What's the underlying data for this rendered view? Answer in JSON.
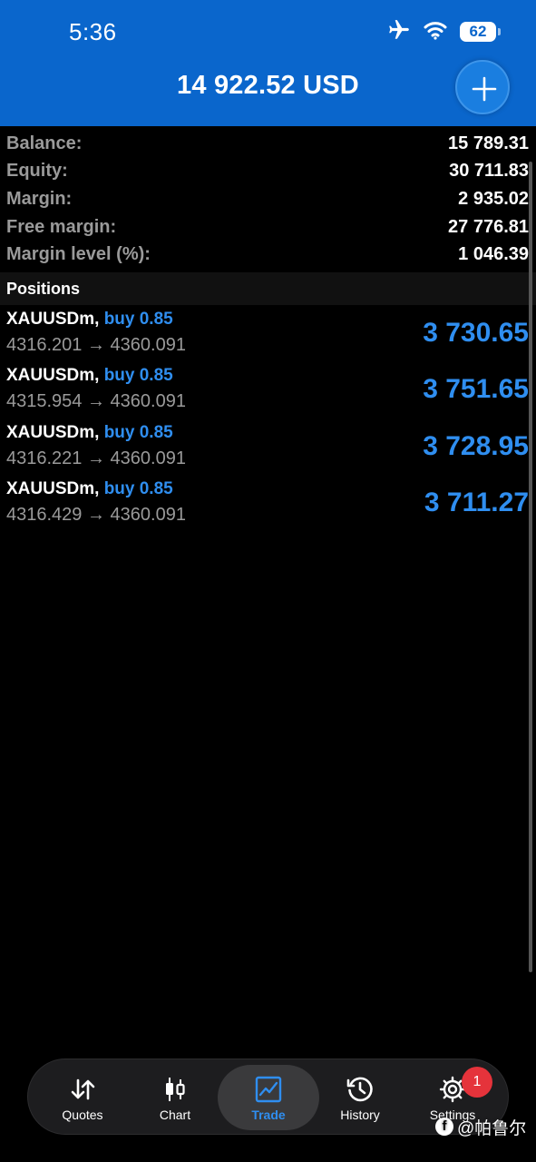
{
  "status_bar": {
    "time": "5:36",
    "battery": "62",
    "icons": [
      "airplane-icon",
      "wifi-icon",
      "battery-icon"
    ]
  },
  "header": {
    "title": "14 922.52 USD",
    "add_icon": "plus-icon",
    "background_color": "#0a66cc"
  },
  "summary": [
    {
      "label": "Balance:",
      "value": "15 789.31"
    },
    {
      "label": "Equity:",
      "value": "30 711.83"
    },
    {
      "label": "Margin:",
      "value": "2 935.02"
    },
    {
      "label": "Free margin:",
      "value": "27 776.81"
    },
    {
      "label": "Margin level (%):",
      "value": "1 046.39"
    }
  ],
  "positions": {
    "heading": "Positions",
    "items": [
      {
        "symbol": "XAUUSDm,",
        "side": "buy 0.85",
        "prices": "4316.201 → 4360.091",
        "profit": "3 730.65"
      },
      {
        "symbol": "XAUUSDm,",
        "side": "buy 0.85",
        "prices": "4315.954 → 4360.091",
        "profit": "3 751.65"
      },
      {
        "symbol": "XAUUSDm,",
        "side": "buy 0.85",
        "prices": "4316.221 → 4360.091",
        "profit": "3 728.95"
      },
      {
        "symbol": "XAUUSDm,",
        "side": "buy 0.85",
        "prices": "4316.429 → 4360.091",
        "profit": "3 711.27"
      }
    ]
  },
  "tabbar": {
    "tabs": [
      {
        "label": "Quotes",
        "icon": "quotes-arrows-icon"
      },
      {
        "label": "Chart",
        "icon": "candlestick-icon"
      },
      {
        "label": "Trade",
        "icon": "trade-chart-icon",
        "active": true
      },
      {
        "label": "History",
        "icon": "history-clock-icon"
      },
      {
        "label": "Settings",
        "icon": "gear-icon"
      }
    ],
    "settings_badge": "1",
    "accent_color": "#2f8ef0"
  },
  "watermark": {
    "text": "@帕鲁尔",
    "logo_letter": "f"
  }
}
